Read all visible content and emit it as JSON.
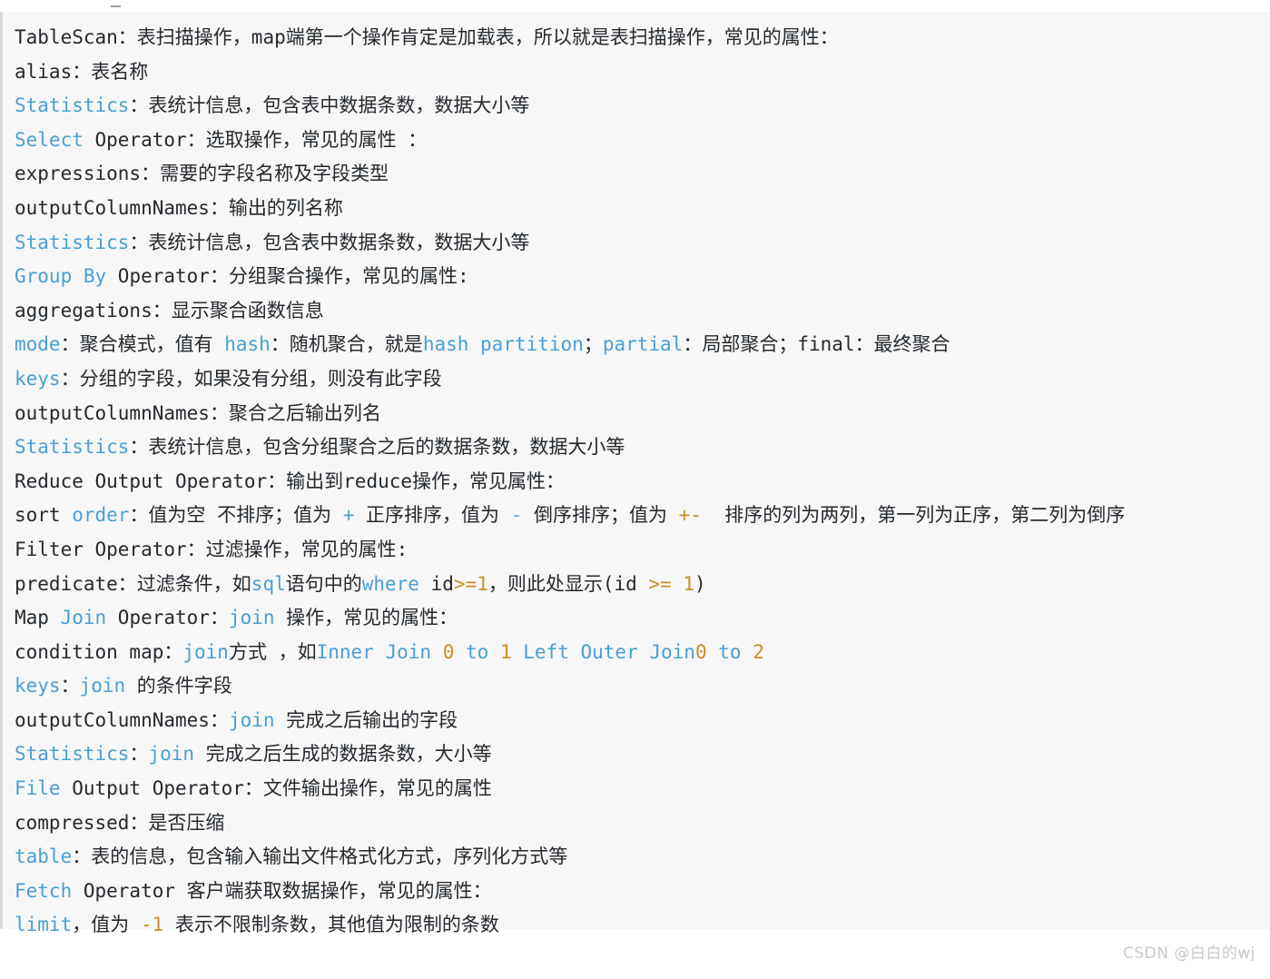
{
  "watermark": {
    "text": "CSDN @白白的wj"
  },
  "colors": {
    "keyword_blue": "#4a9fd4",
    "number_orange": "#c8902a",
    "text_black": "#24292e",
    "block_background": "#f7f7f7",
    "block_border": "#dcdcdc",
    "watermark_gray": "#c9c9c9",
    "page_background": "#ffffff"
  },
  "code_block": {
    "lines": [
      {
        "id": "line-tablescan",
        "segments": [
          {
            "t": "TableScan",
            "c": "plain"
          },
          {
            "t": "：表扫描操作，map端第一个操作肯定是加载表，所以就是表扫描操作，常见的属性：",
            "c": "plain"
          }
        ]
      },
      {
        "id": "line-alias",
        "segments": [
          {
            "t": "alias",
            "c": "plain"
          },
          {
            "t": "：表名称",
            "c": "plain"
          }
        ]
      },
      {
        "id": "line-statistics-1",
        "segments": [
          {
            "t": "Statistics",
            "c": "kw"
          },
          {
            "t": "：表统计信息，包含表中数据条数，数据大小等",
            "c": "plain"
          }
        ]
      },
      {
        "id": "line-select-operator",
        "segments": [
          {
            "t": "Select",
            "c": "kw"
          },
          {
            "t": " Operator：选取操作，常见的属性 ：",
            "c": "plain"
          }
        ]
      },
      {
        "id": "line-expressions",
        "segments": [
          {
            "t": "expressions",
            "c": "plain"
          },
          {
            "t": "：需要的字段名称及字段类型",
            "c": "plain"
          }
        ]
      },
      {
        "id": "line-outputcolumnnames-1",
        "segments": [
          {
            "t": "outputColumnNames",
            "c": "plain"
          },
          {
            "t": "：输出的列名称",
            "c": "plain"
          }
        ]
      },
      {
        "id": "line-statistics-2",
        "segments": [
          {
            "t": "Statistics",
            "c": "kw"
          },
          {
            "t": "：表统计信息，包含表中数据条数，数据大小等",
            "c": "plain"
          }
        ]
      },
      {
        "id": "line-groupby-operator",
        "segments": [
          {
            "t": "Group By",
            "c": "kw"
          },
          {
            "t": " Operator：分组聚合操作，常见的属性:",
            "c": "plain"
          }
        ]
      },
      {
        "id": "line-aggregations",
        "segments": [
          {
            "t": "aggregations",
            "c": "plain"
          },
          {
            "t": "：显示聚合函数信息",
            "c": "plain"
          }
        ]
      },
      {
        "id": "line-mode",
        "segments": [
          {
            "t": "mode",
            "c": "kw"
          },
          {
            "t": "：聚合模式，值有 ",
            "c": "plain"
          },
          {
            "t": "hash",
            "c": "kw"
          },
          {
            "t": "：随机聚合，就是",
            "c": "plain"
          },
          {
            "t": "hash partition",
            "c": "kw"
          },
          {
            "t": "；",
            "c": "plain"
          },
          {
            "t": "partial",
            "c": "kw"
          },
          {
            "t": "：局部聚合；",
            "c": "plain"
          },
          {
            "t": "final",
            "c": "plain"
          },
          {
            "t": "：最终聚合",
            "c": "plain"
          }
        ]
      },
      {
        "id": "line-keys-1",
        "segments": [
          {
            "t": "keys",
            "c": "kw"
          },
          {
            "t": "：分组的字段，如果没有分组，则没有此字段",
            "c": "plain"
          }
        ]
      },
      {
        "id": "line-outputcolumnnames-2",
        "segments": [
          {
            "t": "outputColumnNames",
            "c": "plain"
          },
          {
            "t": "：聚合之后输出列名",
            "c": "plain"
          }
        ]
      },
      {
        "id": "line-statistics-3",
        "segments": [
          {
            "t": "Statistics",
            "c": "kw"
          },
          {
            "t": "：表统计信息，包含分组聚合之后的数据条数，数据大小等",
            "c": "plain"
          }
        ]
      },
      {
        "id": "line-reduce-output-operator",
        "segments": [
          {
            "t": "Reduce Output Operator",
            "c": "plain"
          },
          {
            "t": "：输出到reduce操作，常见属性：",
            "c": "plain"
          }
        ]
      },
      {
        "id": "line-sort-order",
        "segments": [
          {
            "t": "sort ",
            "c": "plain"
          },
          {
            "t": "order",
            "c": "kw"
          },
          {
            "t": "：值为空 不排序；值为 ",
            "c": "plain"
          },
          {
            "t": "+",
            "c": "kw"
          },
          {
            "t": " 正序排序，值为 ",
            "c": "plain"
          },
          {
            "t": "-",
            "c": "kw"
          },
          {
            "t": " 倒序排序；值为 ",
            "c": "plain"
          },
          {
            "t": "+-",
            "c": "num"
          },
          {
            "t": "  排序的列为两列，第一列为正序，第二列为倒序",
            "c": "plain"
          }
        ]
      },
      {
        "id": "line-filter-operator",
        "segments": [
          {
            "t": "Filter Operator",
            "c": "plain"
          },
          {
            "t": "：过滤操作，常见的属性:",
            "c": "plain"
          }
        ]
      },
      {
        "id": "line-predicate",
        "segments": [
          {
            "t": "predicate",
            "c": "plain"
          },
          {
            "t": "：过滤条件，如",
            "c": "plain"
          },
          {
            "t": "sql",
            "c": "kw"
          },
          {
            "t": "语句中的",
            "c": "plain"
          },
          {
            "t": "where",
            "c": "kw"
          },
          {
            "t": " id",
            "c": "plain"
          },
          {
            "t": ">=",
            "c": "num"
          },
          {
            "t": "1",
            "c": "num"
          },
          {
            "t": "，则此处显示",
            "c": "plain"
          },
          {
            "t": "(id ",
            "c": "plain"
          },
          {
            "t": ">=",
            "c": "num"
          },
          {
            "t": " ",
            "c": "plain"
          },
          {
            "t": "1",
            "c": "num"
          },
          {
            "t": ")",
            "c": "plain"
          }
        ]
      },
      {
        "id": "line-mapjoin-operator",
        "segments": [
          {
            "t": "Map ",
            "c": "plain"
          },
          {
            "t": "Join",
            "c": "kw"
          },
          {
            "t": " Operator：",
            "c": "plain"
          },
          {
            "t": "join",
            "c": "kw"
          },
          {
            "t": " 操作，常见的属性：",
            "c": "plain"
          }
        ]
      },
      {
        "id": "line-condition-map",
        "segments": [
          {
            "t": "condition map",
            "c": "plain"
          },
          {
            "t": "：",
            "c": "plain"
          },
          {
            "t": "join",
            "c": "kw"
          },
          {
            "t": "方式 ，如",
            "c": "plain"
          },
          {
            "t": "Inner Join",
            "c": "kw"
          },
          {
            "t": " ",
            "c": "plain"
          },
          {
            "t": "0",
            "c": "num"
          },
          {
            "t": " ",
            "c": "plain"
          },
          {
            "t": "to",
            "c": "kw"
          },
          {
            "t": " ",
            "c": "plain"
          },
          {
            "t": "1",
            "c": "num"
          },
          {
            "t": " ",
            "c": "plain"
          },
          {
            "t": "Left Outer Join",
            "c": "kw"
          },
          {
            "t": "0",
            "c": "num"
          },
          {
            "t": " ",
            "c": "plain"
          },
          {
            "t": "to",
            "c": "kw"
          },
          {
            "t": " ",
            "c": "plain"
          },
          {
            "t": "2",
            "c": "num"
          }
        ]
      },
      {
        "id": "line-keys-2",
        "segments": [
          {
            "t": "keys",
            "c": "kw"
          },
          {
            "t": "：",
            "c": "plain"
          },
          {
            "t": "join",
            "c": "kw"
          },
          {
            "t": " 的条件字段",
            "c": "plain"
          }
        ]
      },
      {
        "id": "line-outputcolumnnames-3",
        "segments": [
          {
            "t": "outputColumnNames",
            "c": "plain"
          },
          {
            "t": "：",
            "c": "plain"
          },
          {
            "t": "join",
            "c": "kw"
          },
          {
            "t": " 完成之后输出的字段",
            "c": "plain"
          }
        ]
      },
      {
        "id": "line-statistics-4",
        "segments": [
          {
            "t": "Statistics",
            "c": "kw"
          },
          {
            "t": "：",
            "c": "plain"
          },
          {
            "t": "join",
            "c": "kw"
          },
          {
            "t": " 完成之后生成的数据条数，大小等",
            "c": "plain"
          }
        ]
      },
      {
        "id": "line-file-output-operator",
        "segments": [
          {
            "t": "File",
            "c": "kw"
          },
          {
            "t": " Output Operator：文件输出操作，常见的属性",
            "c": "plain"
          }
        ]
      },
      {
        "id": "line-compressed",
        "segments": [
          {
            "t": "compressed",
            "c": "plain"
          },
          {
            "t": "：是否压缩",
            "c": "plain"
          }
        ]
      },
      {
        "id": "line-table",
        "segments": [
          {
            "t": "table",
            "c": "kw"
          },
          {
            "t": "：表的信息，包含输入输出文件格式化方式，序列化方式等",
            "c": "plain"
          }
        ]
      },
      {
        "id": "line-fetch-operator",
        "segments": [
          {
            "t": "Fetch",
            "c": "kw"
          },
          {
            "t": " Operator 客户端获取数据操作，常见的属性：",
            "c": "plain"
          }
        ]
      },
      {
        "id": "line-limit",
        "segments": [
          {
            "t": "limit",
            "c": "kw"
          },
          {
            "t": "，值为 ",
            "c": "plain"
          },
          {
            "t": "-1",
            "c": "num"
          },
          {
            "t": " 表示不限制条数，其他值为限制的条数",
            "c": "plain"
          }
        ]
      }
    ]
  }
}
